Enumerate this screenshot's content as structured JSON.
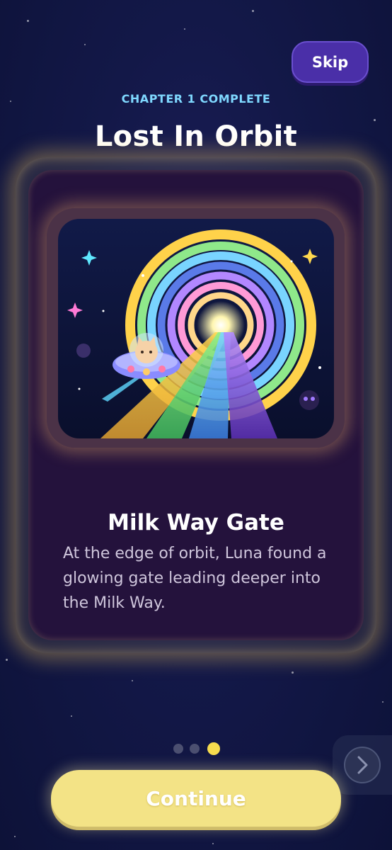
{
  "header": {
    "skip_label": "Skip",
    "chapter_label": "CHAPTER 1 COMPLETE",
    "title": "Lost In Orbit"
  },
  "card": {
    "title": "Milk Way Gate",
    "description": "At the edge of orbit, Luna found a glowing gate leading deeper into the Milk Way."
  },
  "pagination": {
    "total": 3,
    "active_index": 2
  },
  "footer": {
    "continue_label": "Continue"
  },
  "colors": {
    "background": "#131848",
    "accent_yellow": "#f6dc4e",
    "skip_button": "#4a2fa8",
    "chapter_text": "#7fd8ff",
    "card_background": "#24123c"
  },
  "icons": {
    "next": "chevron-right-icon"
  }
}
